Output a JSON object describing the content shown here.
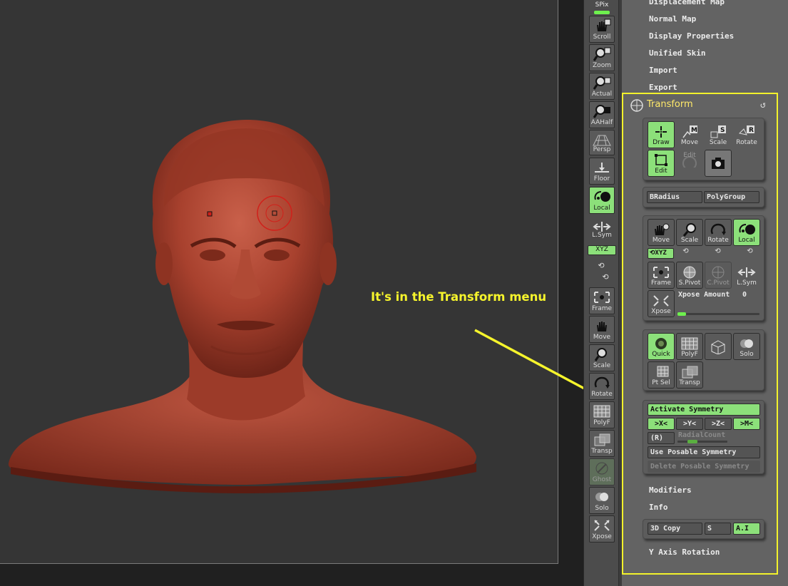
{
  "shelf": {
    "spix": "SPix",
    "buttons": [
      {
        "label": "Scroll",
        "icon": "hand-icon"
      },
      {
        "label": "Zoom",
        "icon": "magnifier-icon"
      },
      {
        "label": "Actual",
        "icon": "magnifier-icon"
      },
      {
        "label": "AAHalf",
        "icon": "magnifier-icon"
      },
      {
        "label": "Persp",
        "icon": "grid-icon"
      },
      {
        "label": "Floor",
        "icon": "floor-icon"
      },
      {
        "label": "Local",
        "icon": "local-icon"
      },
      {
        "label": "L.Sym",
        "icon": "arrows-icon"
      },
      {
        "label": "XYZ",
        "icon": "rotate-icon"
      },
      {
        "label": "Frame",
        "icon": "frame-icon"
      },
      {
        "label": "Move",
        "icon": "hand-icon"
      },
      {
        "label": "Scale",
        "icon": "magnifier-icon"
      },
      {
        "label": "Rotate",
        "icon": "rotate-icon"
      },
      {
        "label": "PolyF",
        "icon": "grid-icon"
      },
      {
        "label": "Transp",
        "icon": "transp-icon"
      },
      {
        "label": "Ghost",
        "icon": "ghost-icon"
      },
      {
        "label": "Solo",
        "icon": "solo-icon"
      },
      {
        "label": "Xpose",
        "icon": "xpose-icon"
      }
    ]
  },
  "menu_top": [
    "Displacement Map",
    "Normal Map",
    "Display Properties",
    "Unified Skin",
    "Import",
    "Export"
  ],
  "transform": {
    "title": "Transform",
    "mode_buttons": [
      "Draw",
      "Move",
      "Scale",
      "Rotate",
      "Edit",
      "Edit"
    ],
    "bradius": "BRadius",
    "polygroup": "PolyGroup",
    "nav_buttons": [
      "Move",
      "Scale",
      "Rotate",
      "Local"
    ],
    "xyz": "XYZ",
    "frame_buttons": [
      "Frame",
      "S.Pivot",
      "C.Pivot",
      "L.Sym"
    ],
    "xpose": "Xpose",
    "xpose_amount_label": "Xpose Amount",
    "xpose_amount_value": "0",
    "display_buttons": [
      "Quick",
      "PolyF",
      "",
      "Solo",
      "Pt Sel",
      "Transp"
    ],
    "activate_symmetry": "Activate Symmetry",
    "axes": [
      ">X<",
      ">Y<",
      ">Z<",
      ">M<"
    ],
    "radial_r": "(R)",
    "radial_count": "RadialCount",
    "use_posable": "Use Posable Symmetry",
    "delete_posable": "Delete Posable Symmetry",
    "modifiers": "Modifiers",
    "info": "Info",
    "copy_3d": "3D Copy",
    "copy_s": "S",
    "copy_ai": "A.I",
    "y_axis_rotation": "Y Axis Rotation"
  },
  "annotation": {
    "text": "It's in the Transform menu",
    "color": "#f6f42c"
  },
  "colors": {
    "accent_green": "#8ce07a",
    "highlight_yellow": "#f3f22b",
    "sculpt_red": "#a8412e"
  }
}
